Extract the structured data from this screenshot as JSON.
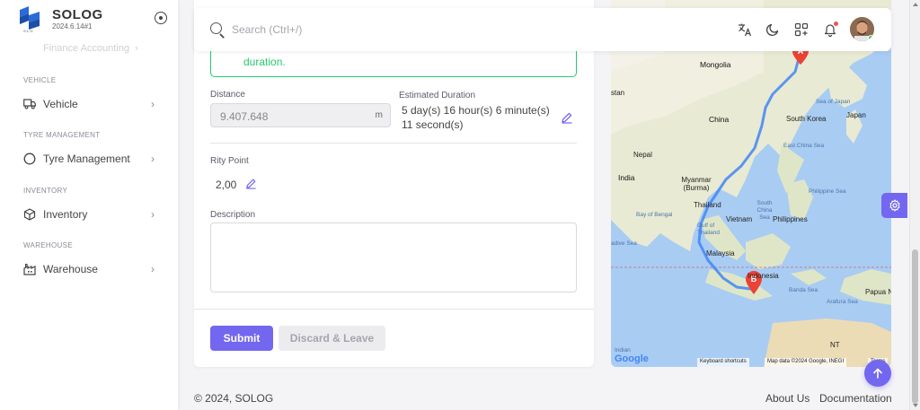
{
  "brand": {
    "name": "SOLOG",
    "version": "2024.6.14#1"
  },
  "sidebar": {
    "faded_item": "Finance Accounting",
    "sections": [
      {
        "title": "VEHICLE",
        "item": "Vehicle",
        "icon": "truck-icon"
      },
      {
        "title": "TYRE MANAGEMENT",
        "item": "Tyre Management",
        "icon": "circle-icon"
      },
      {
        "title": "INVENTORY",
        "item": "Inventory",
        "icon": "box-icon"
      },
      {
        "title": "WAREHOUSE",
        "item": "Warehouse",
        "icon": "building-icon"
      }
    ]
  },
  "navbar": {
    "search_placeholder": "Search (Ctrl+/)",
    "icons": [
      "translate-icon",
      "moon-icon",
      "apps-icon",
      "bell-icon"
    ]
  },
  "form": {
    "alert_text": "duration.",
    "distance_label": "Distance",
    "distance_value": "9.407.648",
    "distance_unit": "m",
    "duration_label": "Estimated Duration",
    "duration_value": "5 day(s) 16 hour(s) 6 minute(s) 11 second(s)",
    "rity_label": "Rity Point",
    "rity_value": "2,00",
    "description_label": "Description",
    "description_value": "",
    "submit_label": "Submit",
    "discard_label": "Discard & Leave"
  },
  "map": {
    "labels": {
      "mongolia": "Mongolia",
      "china": "China",
      "south_korea": "South Korea",
      "japan": "Japan",
      "sea_of_japan": "Sea of Japan",
      "east_china_sea": "East China Sea",
      "nepal": "Nepal",
      "india": "India",
      "myanmar": "Myanmar (Burma)",
      "thailand": "Thailand",
      "vietnam": "Vietnam",
      "philippines": "Philippines",
      "philippine_sea": "Philippine Sea",
      "bay_of_bengal": "Bay of Bengal",
      "south_china_sea": "South China Sea",
      "gulf_of_thailand": "Gulf of Thailand",
      "malaysia": "Malaysia",
      "indonesia": "Indonesia",
      "banda_sea": "Banda Sea",
      "arafura_sea": "Arafura Sea",
      "papua": "Papua Ne",
      "indian": "Indian",
      "nt": "NT",
      "stan": "stan",
      "adive_sea": "adive Sea"
    },
    "marker_a": "A",
    "marker_b": "B",
    "google": "Google",
    "keyboard_shortcuts": "Keyboard shortcuts",
    "map_data": "Map data ©2024 Google, INEGI",
    "terms": "Terms"
  },
  "footer": {
    "copyright": "© 2024, SOLOG",
    "about": "About Us",
    "documentation": "Documentation"
  },
  "colors": {
    "primary": "#7367f0",
    "success": "#28c76f",
    "danger": "#ea5455"
  }
}
